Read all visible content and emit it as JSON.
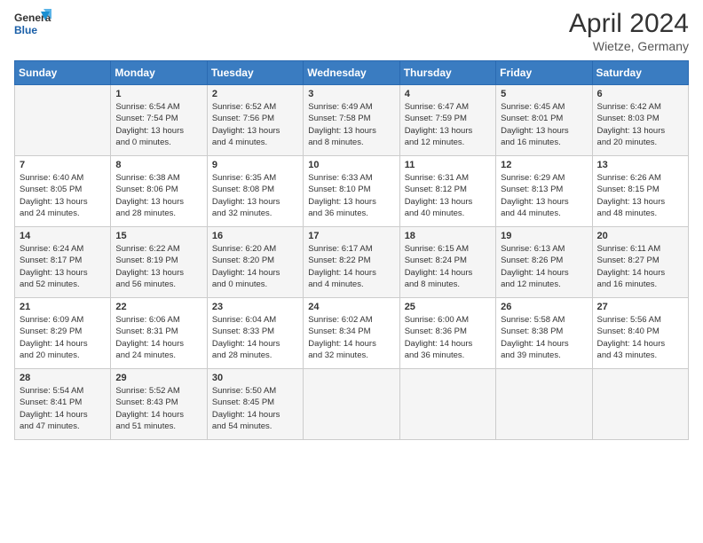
{
  "header": {
    "logo_line1": "General",
    "logo_line2": "Blue",
    "title": "April 2024",
    "location": "Wietze, Germany"
  },
  "weekdays": [
    "Sunday",
    "Monday",
    "Tuesday",
    "Wednesday",
    "Thursday",
    "Friday",
    "Saturday"
  ],
  "weeks": [
    [
      {
        "day": "",
        "text": ""
      },
      {
        "day": "1",
        "text": "Sunrise: 6:54 AM\nSunset: 7:54 PM\nDaylight: 13 hours\nand 0 minutes."
      },
      {
        "day": "2",
        "text": "Sunrise: 6:52 AM\nSunset: 7:56 PM\nDaylight: 13 hours\nand 4 minutes."
      },
      {
        "day": "3",
        "text": "Sunrise: 6:49 AM\nSunset: 7:58 PM\nDaylight: 13 hours\nand 8 minutes."
      },
      {
        "day": "4",
        "text": "Sunrise: 6:47 AM\nSunset: 7:59 PM\nDaylight: 13 hours\nand 12 minutes."
      },
      {
        "day": "5",
        "text": "Sunrise: 6:45 AM\nSunset: 8:01 PM\nDaylight: 13 hours\nand 16 minutes."
      },
      {
        "day": "6",
        "text": "Sunrise: 6:42 AM\nSunset: 8:03 PM\nDaylight: 13 hours\nand 20 minutes."
      }
    ],
    [
      {
        "day": "7",
        "text": "Sunrise: 6:40 AM\nSunset: 8:05 PM\nDaylight: 13 hours\nand 24 minutes."
      },
      {
        "day": "8",
        "text": "Sunrise: 6:38 AM\nSunset: 8:06 PM\nDaylight: 13 hours\nand 28 minutes."
      },
      {
        "day": "9",
        "text": "Sunrise: 6:35 AM\nSunset: 8:08 PM\nDaylight: 13 hours\nand 32 minutes."
      },
      {
        "day": "10",
        "text": "Sunrise: 6:33 AM\nSunset: 8:10 PM\nDaylight: 13 hours\nand 36 minutes."
      },
      {
        "day": "11",
        "text": "Sunrise: 6:31 AM\nSunset: 8:12 PM\nDaylight: 13 hours\nand 40 minutes."
      },
      {
        "day": "12",
        "text": "Sunrise: 6:29 AM\nSunset: 8:13 PM\nDaylight: 13 hours\nand 44 minutes."
      },
      {
        "day": "13",
        "text": "Sunrise: 6:26 AM\nSunset: 8:15 PM\nDaylight: 13 hours\nand 48 minutes."
      }
    ],
    [
      {
        "day": "14",
        "text": "Sunrise: 6:24 AM\nSunset: 8:17 PM\nDaylight: 13 hours\nand 52 minutes."
      },
      {
        "day": "15",
        "text": "Sunrise: 6:22 AM\nSunset: 8:19 PM\nDaylight: 13 hours\nand 56 minutes."
      },
      {
        "day": "16",
        "text": "Sunrise: 6:20 AM\nSunset: 8:20 PM\nDaylight: 14 hours\nand 0 minutes."
      },
      {
        "day": "17",
        "text": "Sunrise: 6:17 AM\nSunset: 8:22 PM\nDaylight: 14 hours\nand 4 minutes."
      },
      {
        "day": "18",
        "text": "Sunrise: 6:15 AM\nSunset: 8:24 PM\nDaylight: 14 hours\nand 8 minutes."
      },
      {
        "day": "19",
        "text": "Sunrise: 6:13 AM\nSunset: 8:26 PM\nDaylight: 14 hours\nand 12 minutes."
      },
      {
        "day": "20",
        "text": "Sunrise: 6:11 AM\nSunset: 8:27 PM\nDaylight: 14 hours\nand 16 minutes."
      }
    ],
    [
      {
        "day": "21",
        "text": "Sunrise: 6:09 AM\nSunset: 8:29 PM\nDaylight: 14 hours\nand 20 minutes."
      },
      {
        "day": "22",
        "text": "Sunrise: 6:06 AM\nSunset: 8:31 PM\nDaylight: 14 hours\nand 24 minutes."
      },
      {
        "day": "23",
        "text": "Sunrise: 6:04 AM\nSunset: 8:33 PM\nDaylight: 14 hours\nand 28 minutes."
      },
      {
        "day": "24",
        "text": "Sunrise: 6:02 AM\nSunset: 8:34 PM\nDaylight: 14 hours\nand 32 minutes."
      },
      {
        "day": "25",
        "text": "Sunrise: 6:00 AM\nSunset: 8:36 PM\nDaylight: 14 hours\nand 36 minutes."
      },
      {
        "day": "26",
        "text": "Sunrise: 5:58 AM\nSunset: 8:38 PM\nDaylight: 14 hours\nand 39 minutes."
      },
      {
        "day": "27",
        "text": "Sunrise: 5:56 AM\nSunset: 8:40 PM\nDaylight: 14 hours\nand 43 minutes."
      }
    ],
    [
      {
        "day": "28",
        "text": "Sunrise: 5:54 AM\nSunset: 8:41 PM\nDaylight: 14 hours\nand 47 minutes."
      },
      {
        "day": "29",
        "text": "Sunrise: 5:52 AM\nSunset: 8:43 PM\nDaylight: 14 hours\nand 51 minutes."
      },
      {
        "day": "30",
        "text": "Sunrise: 5:50 AM\nSunset: 8:45 PM\nDaylight: 14 hours\nand 54 minutes."
      },
      {
        "day": "",
        "text": ""
      },
      {
        "day": "",
        "text": ""
      },
      {
        "day": "",
        "text": ""
      },
      {
        "day": "",
        "text": ""
      }
    ]
  ]
}
